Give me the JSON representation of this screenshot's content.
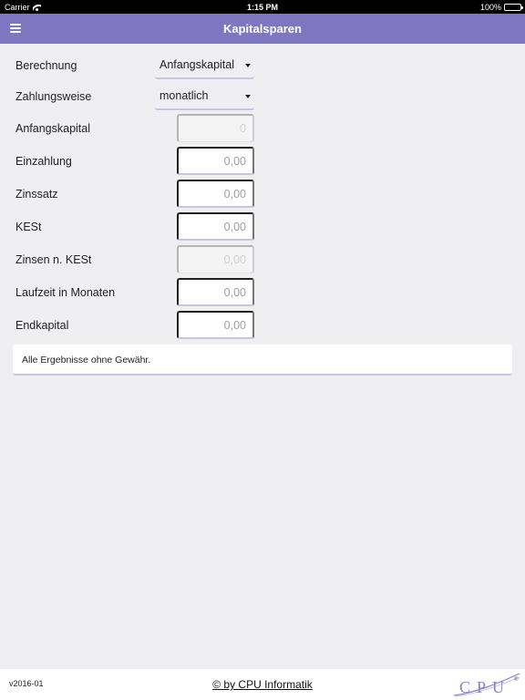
{
  "status_bar": {
    "carrier": "Carrier",
    "time": "1:15 PM",
    "battery": "100%"
  },
  "nav": {
    "title": "Kapitalsparen",
    "menu_icon": "hamburger-menu-icon"
  },
  "form": {
    "berechnung": {
      "label": "Berechnung",
      "value": "Anfangskapital"
    },
    "zahlungsweise": {
      "label": "Zahlungsweise",
      "value": "monatlich"
    },
    "anfangskapital": {
      "label": "Anfangskapital",
      "placeholder": "0"
    },
    "einzahlung": {
      "label": "Einzahlung",
      "placeholder": "0,00"
    },
    "zinssatz": {
      "label": "Zinssatz",
      "placeholder": "0,00"
    },
    "kest": {
      "label": "KESt",
      "placeholder": "0,00"
    },
    "zinsen_kest": {
      "label": "Zinsen n. KESt",
      "placeholder": "0,00"
    },
    "laufzeit": {
      "label": "Laufzeit in Monaten",
      "placeholder": "0,00"
    },
    "endkapital": {
      "label": "Endkapital",
      "placeholder": "0,00"
    }
  },
  "disclaimer": "Alle Ergebnisse ohne Gewähr.",
  "footer": {
    "version": "v2016-01",
    "credit": "© by CPU Informatik",
    "logo_text": "CPU",
    "logo_mark": "®"
  },
  "colors": {
    "accent": "#7f76c0",
    "underline": "#c8c4e4",
    "background": "#efeff1"
  }
}
